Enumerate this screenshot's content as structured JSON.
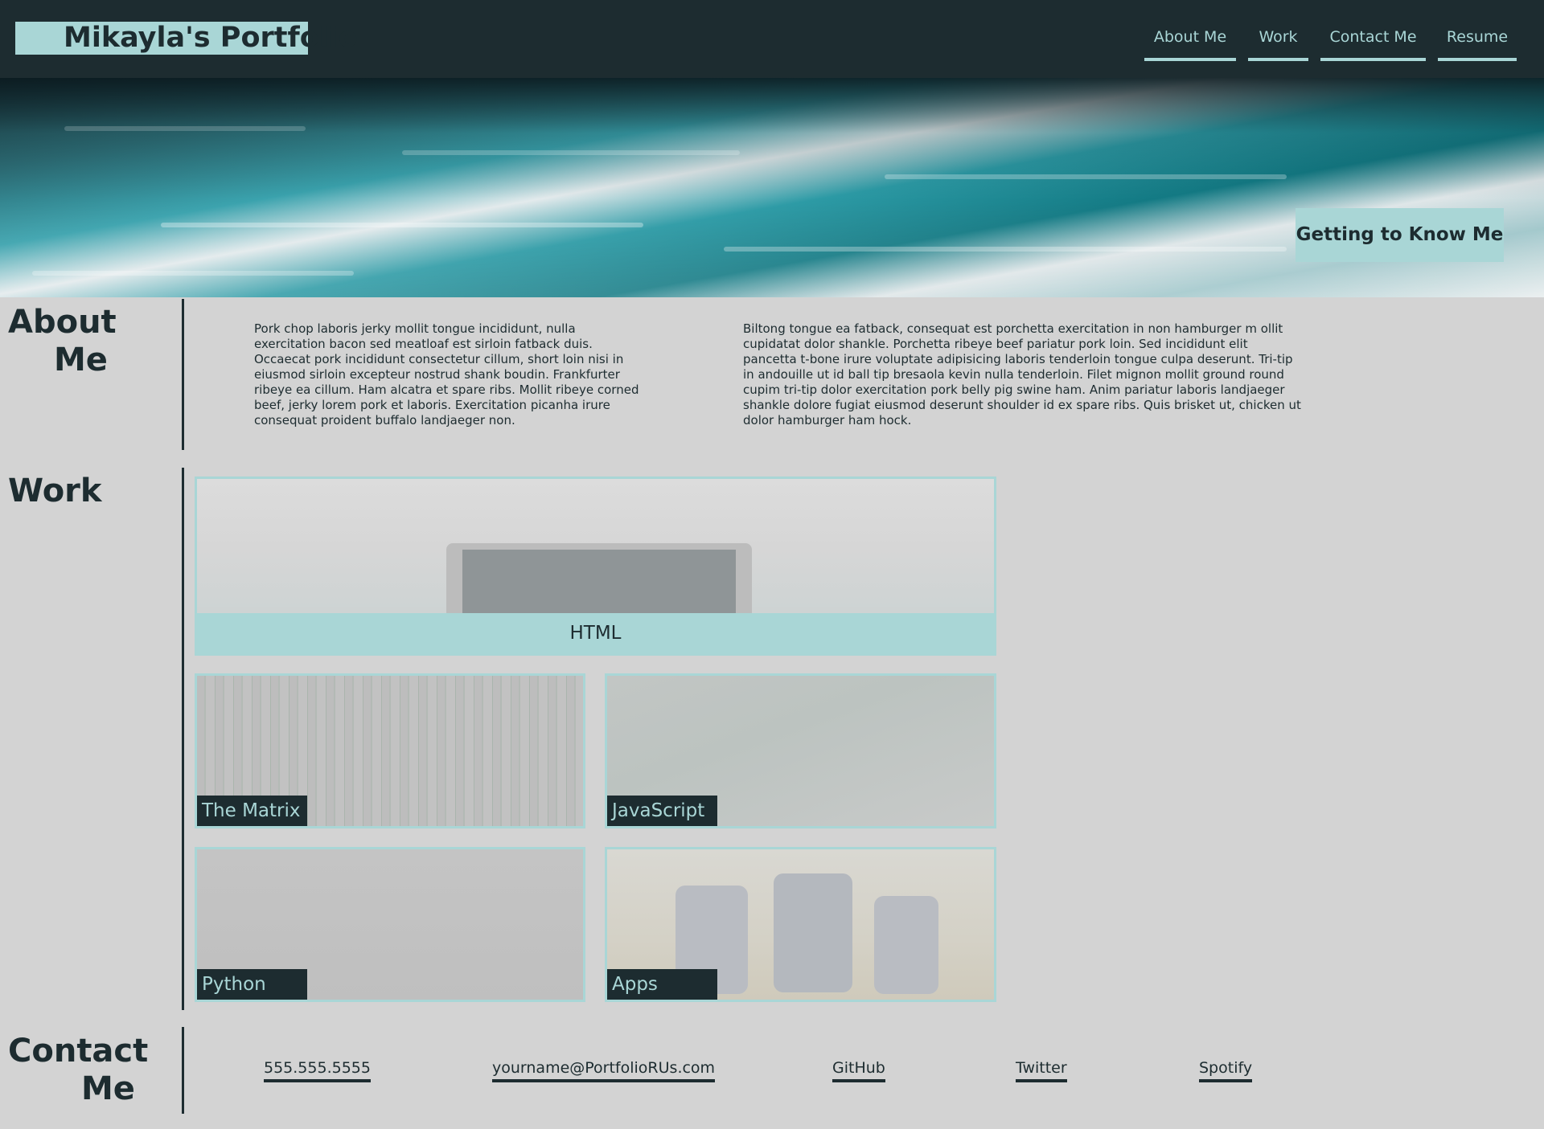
{
  "header": {
    "brand": "Mikayla's Portfolio",
    "nav": [
      {
        "label": "About Me"
      },
      {
        "label": "Work"
      },
      {
        "label": "Contact Me"
      },
      {
        "label": "Resume"
      }
    ]
  },
  "hero": {
    "cta_label": "Getting to Know Me"
  },
  "about": {
    "title_line1": "About",
    "title_line2": "Me",
    "paragraphs": [
      "Pork chop laboris jerky mollit tongue incididunt, nulla exercitation bacon sed meatloaf est sirloin fatback duis. Occaecat pork incididunt consectetur cillum, short loin nisi in eiusmod sirloin excepteur nostrud shank boudin. Frankfurter ribeye ea cillum. Ham alcatra et spare ribs. Mollit ribeye corned beef, jerky lorem pork et laboris. Exercitation picanha irure consequat proident buffalo landjaeger non.",
      "Biltong tongue ea fatback, consequat est porchetta exercitation in non hamburger m ollit cupidatat dolor shankle. Porchetta ribeye beef pariatur pork loin. Sed incididunt elit pancetta t-bone irure voluptate adipisicing laboris tenderloin tongue culpa deserunt. Tri-tip in andouille ut id ball tip bresaola kevin nulla tenderloin. Filet mignon mollit ground round cupim tri-tip dolor exercitation pork belly pig swine ham. Anim pariatur laboris landjaeger shankle dolore fugiat eiusmod deserunt shoulder id ex spare ribs. Quis brisket ut, chicken ut dolor hamburger ham hock."
    ]
  },
  "work": {
    "title": "Work",
    "projects": [
      {
        "label": "HTML"
      },
      {
        "label": "The Matrix"
      },
      {
        "label": "JavaScript"
      },
      {
        "label": "Python"
      },
      {
        "label": "Apps"
      }
    ]
  },
  "contact": {
    "title_line1": "Contact",
    "title_line2": "Me",
    "links": [
      {
        "label": "555.555.5555"
      },
      {
        "label": "yourname@PortfolioRUs.com"
      },
      {
        "label": "GitHub"
      },
      {
        "label": "Twitter"
      },
      {
        "label": "Spotify"
      }
    ]
  },
  "colors": {
    "header_bg": "#1d2c30",
    "accent": "#a9d6d6",
    "page_bg": "#d3d3d3",
    "text": "#1d2c30"
  }
}
